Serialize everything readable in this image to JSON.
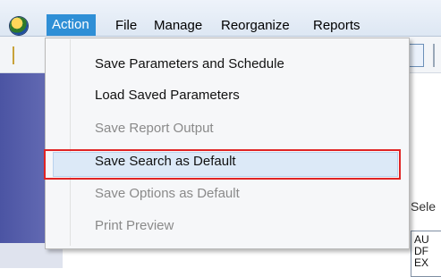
{
  "menubar": {
    "items": [
      {
        "label": "Action"
      },
      {
        "label": "File"
      },
      {
        "label": "Manage"
      },
      {
        "label": "Reorganize"
      },
      {
        "label": "Reports"
      }
    ]
  },
  "dropdown": {
    "items": [
      {
        "label": "Save Parameters and Schedule",
        "enabled": true
      },
      {
        "label": "Load Saved Parameters",
        "enabled": true
      },
      {
        "label": "Save Report Output",
        "enabled": false
      },
      {
        "label": "Save Search as Default",
        "enabled": true,
        "highlighted": true
      },
      {
        "label": "Save Options as Default",
        "enabled": false
      },
      {
        "label": "Print Preview",
        "enabled": false
      }
    ]
  },
  "right_panel": {
    "select_label": "Sele",
    "list_items": [
      "AU",
      "DF",
      "EX"
    ]
  },
  "colors": {
    "menu_active": "#2f8fd6",
    "highlight_border": "#e02424"
  }
}
